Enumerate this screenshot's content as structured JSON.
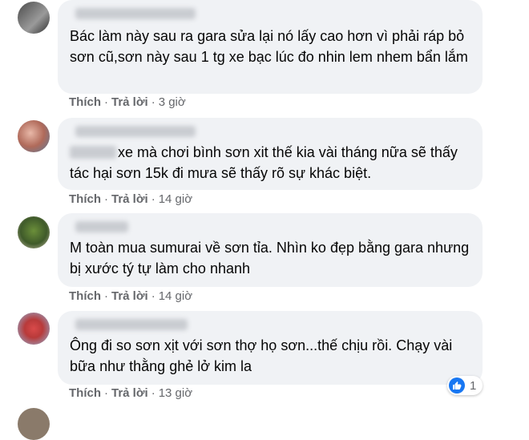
{
  "comments": [
    {
      "text": "Bác làm này sau ra gara sửa lại nó lấy cao hơn vì phải ráp bỏ sơn cũ,sơn này sau 1 tg xe bạc lúc đo nhin lem nhem bẩn lắm",
      "like": "Thích",
      "reply": "Trả lời",
      "time": "3 giờ"
    },
    {
      "text": "xe mà chơi bình sơn xit thế kia vài tháng nữa sẽ thấy tác hại sơn 15k đi mưa sẽ thấy rõ sự khác biệt.",
      "like": "Thích",
      "reply": "Trả lời",
      "time": "14 giờ"
    },
    {
      "text": "M toàn mua sumurai về sơn tỉa. Nhìn ko đẹp bằng gara nhưng bị xước tý tự làm cho nhanh",
      "like": "Thích",
      "reply": "Trả lời",
      "time": "14 giờ"
    },
    {
      "text": "Ông đi so sơn xịt với sơn thợ họ sơn...thế chịu rồi. Chạy vài bữa như thằng ghẻ lở kim la",
      "like": "Thích",
      "reply": "Trả lời",
      "time": "13 giờ",
      "reaction_count": "1"
    }
  ],
  "separator": "·",
  "colors": {
    "bubble": "#f0f2f5",
    "meta": "#65676b",
    "like_blue": "#1877f2"
  }
}
